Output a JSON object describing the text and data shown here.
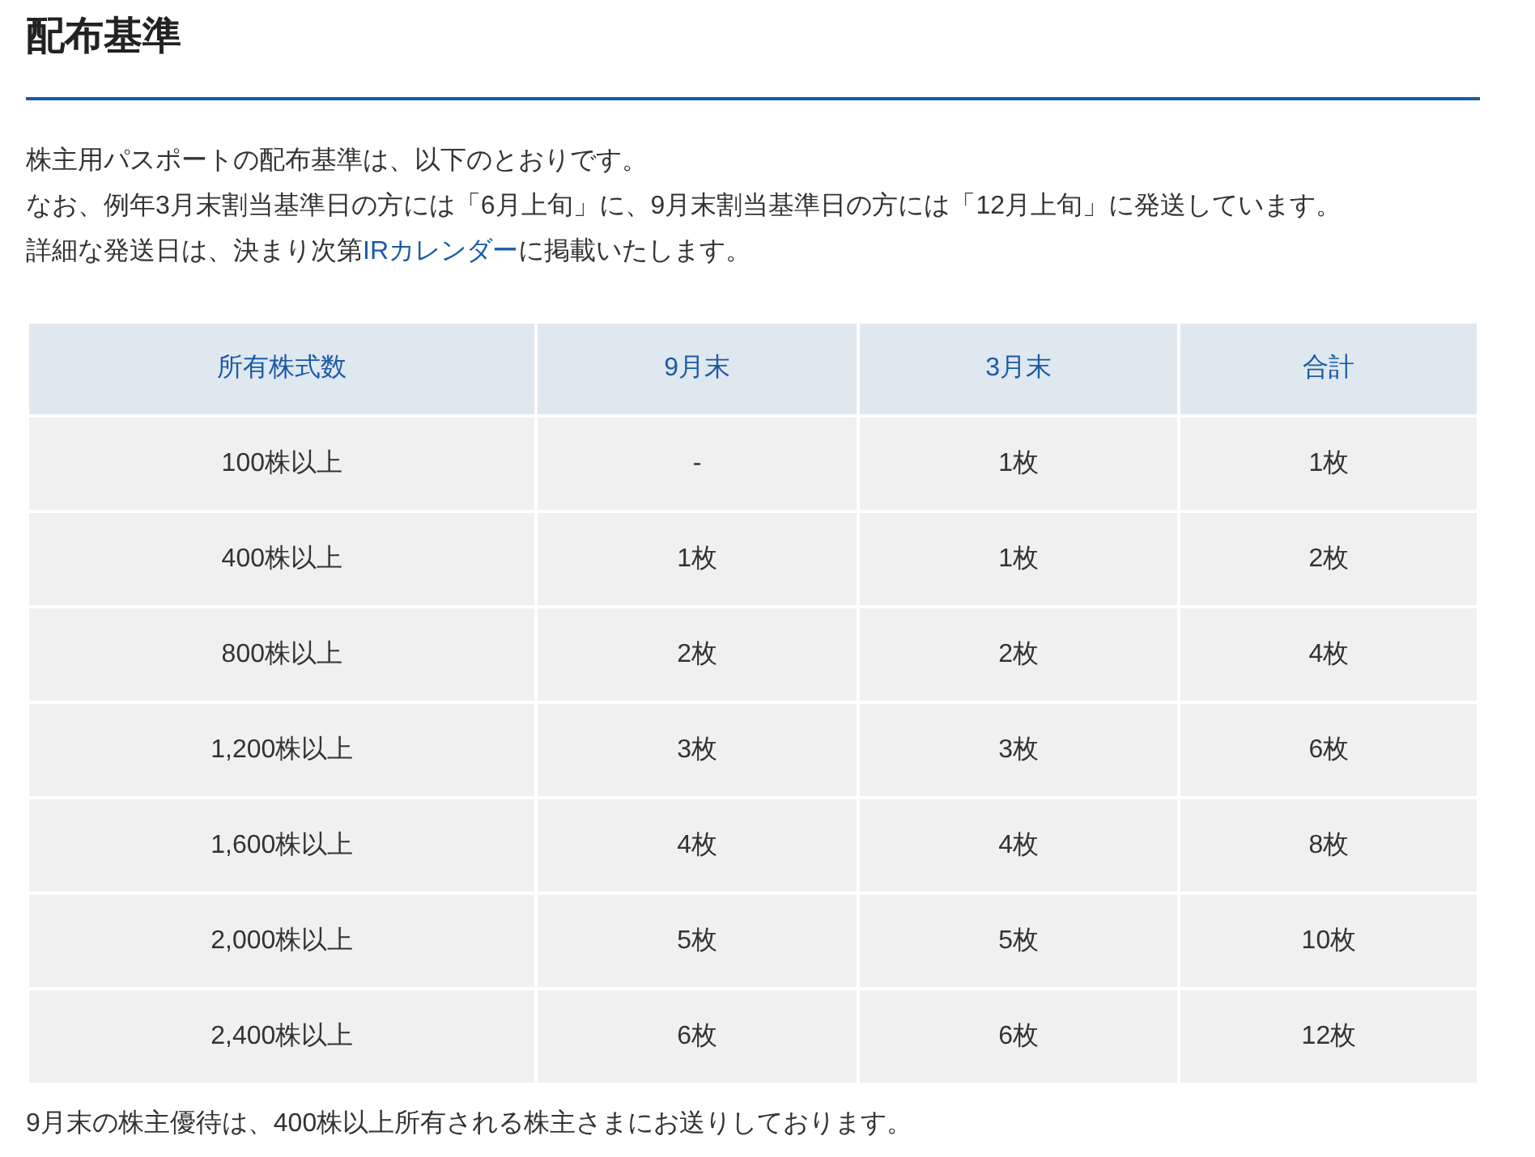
{
  "heading": "配布基準",
  "intro": [
    {
      "text": "株主用パスポートの配布基準は、以下のとおりです。"
    },
    {
      "text": "なお、例年3月末割当基準日の方には「6月上旬」に、9月末割当基準日の方には「12月上旬」に発送しています。"
    },
    {
      "text": "詳細な発送日は、決まり次第",
      "link": "IRカレンダー",
      "after": "に掲載いたします。"
    }
  ],
  "table": {
    "columns": [
      "所有株式数",
      "9月末",
      "3月末",
      "合計"
    ],
    "rows": [
      [
        "100株以上",
        "-",
        "1枚",
        "1枚"
      ],
      [
        "400株以上",
        "1枚",
        "1枚",
        "2枚"
      ],
      [
        "800株以上",
        "2枚",
        "2枚",
        "4枚"
      ],
      [
        "1,200株以上",
        "3枚",
        "3枚",
        "6枚"
      ],
      [
        "1,600株以上",
        "4枚",
        "4枚",
        "8枚"
      ],
      [
        "2,000株以上",
        "5枚",
        "5枚",
        "10枚"
      ],
      [
        "2,400株以上",
        "6枚",
        "6枚",
        "12枚"
      ]
    ]
  },
  "note": "9月末の株主優待は、400株以上所有される株主さまにお送りしております。"
}
